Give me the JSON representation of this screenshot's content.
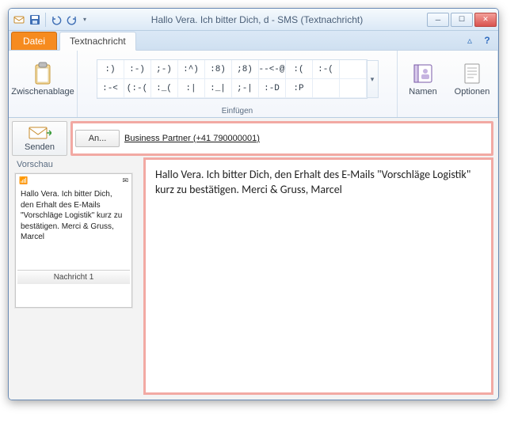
{
  "window": {
    "title": "Hallo Vera. Ich bitter Dich, d  -  SMS (Textnachricht)"
  },
  "tabs": {
    "file": "Datei",
    "textmsg": "Textnachricht"
  },
  "ribbon": {
    "clipboard_label": "Zwischenablage",
    "insert_label": "Einfügen",
    "names_label": "Namen",
    "options_label": "Optionen",
    "emoticons_row1": [
      ":)",
      ":-)",
      ";-)",
      ":^)",
      ":8)",
      ";8)",
      "--<-@",
      ":(",
      ":-("
    ],
    "emoticons_row2": [
      ":-<",
      "(:-(",
      ":_(",
      ":|",
      ":_|",
      ";-|",
      ":-D",
      ":P",
      ""
    ]
  },
  "compose": {
    "send_label": "Senden",
    "to_button": "An...",
    "to_value": "Business Partner (+41 790000001)"
  },
  "preview": {
    "header": "Vorschau",
    "signal_icon": "📶",
    "mail_icon": "✉",
    "text": "Hallo Vera. Ich bitter Dich, den Erhalt des E-Mails \"Vorschläge Logistik\" kurz zu bestätigen. Merci & Gruss, Marcel",
    "nav": "Nachricht 1"
  },
  "message": {
    "body": "Hallo Vera. Ich bitter Dich, den Erhalt des E-Mails \"Vorschläge Logistik\" kurz zu bestätigen. Merci & Gruss, Marcel"
  }
}
